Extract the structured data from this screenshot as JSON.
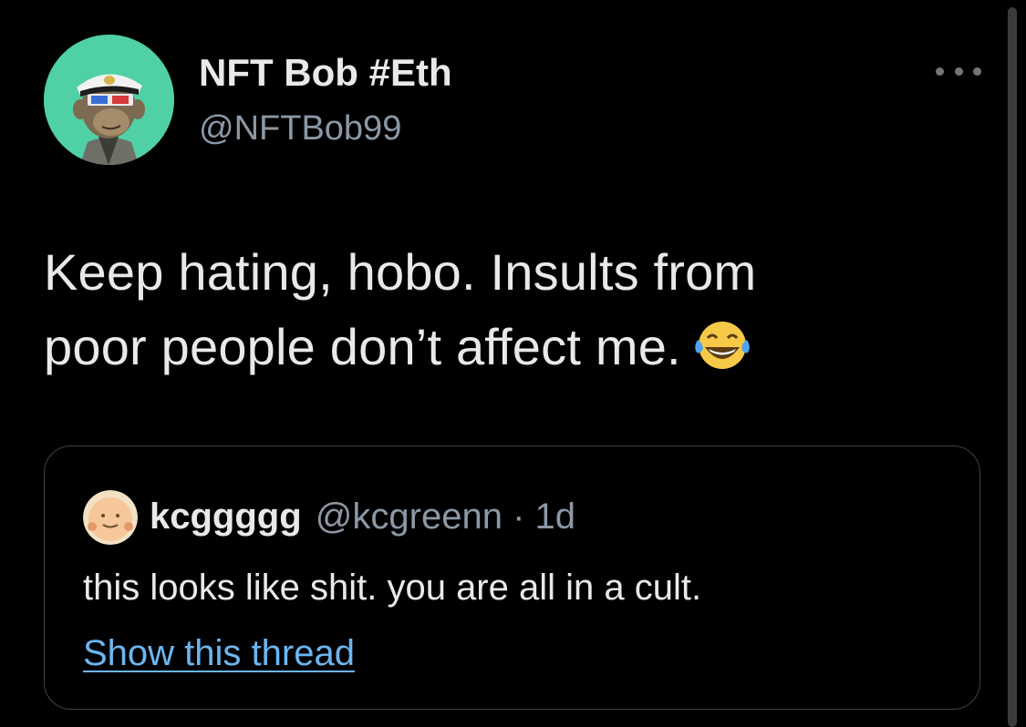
{
  "tweet": {
    "display_name": "NFT Bob #Eth",
    "handle": "@NFTBob99",
    "text_line1": "Keep hating, hobo. Insults from",
    "text_line2": "poor people don’t affect me.",
    "emoji_icon": "face-with-tears-of-joy-icon",
    "avatar_icon": "ape-with-captain-hat-icon"
  },
  "quoted_tweet": {
    "display_name": "kcggggg",
    "handle": "@kcgreenn",
    "separator": "·",
    "time": "1d",
    "text": "this looks like shit. you are all in a cult.",
    "show_thread_label": "Show this thread",
    "avatar_icon": "smiling-face-avatar-icon"
  },
  "colors": {
    "background": "#000000",
    "primary_text": "#e7e9ea",
    "secondary_text": "#8b98a5",
    "link": "#6cb6f0",
    "border": "#3e4144",
    "avatar_bg": "#4fd1a5"
  }
}
